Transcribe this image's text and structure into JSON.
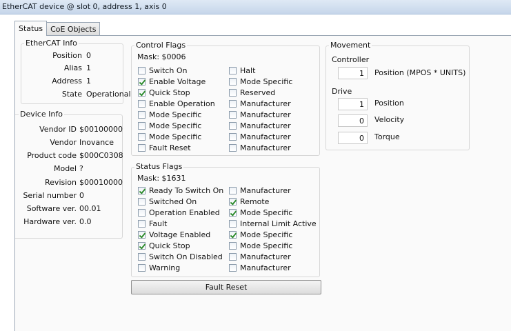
{
  "window": {
    "title": "EtherCAT device @ slot 0, address 1, axis 0"
  },
  "tabs": [
    {
      "label": "Status"
    },
    {
      "label": "CoE Objects"
    }
  ],
  "ethercat_info": {
    "title": "EtherCAT Info",
    "rows": [
      {
        "label": "Position",
        "value": "0"
      },
      {
        "label": "Alias",
        "value": "1"
      },
      {
        "label": "Address",
        "value": "1"
      },
      {
        "label": "State",
        "value": "Operational"
      }
    ]
  },
  "device_info": {
    "title": "Device Info",
    "rows": [
      {
        "label": "Vendor ID",
        "value": "$00100000"
      },
      {
        "label": "Vendor",
        "value": "Inovance"
      },
      {
        "label": "Product code",
        "value": "$000C0308"
      },
      {
        "label": "Model",
        "value": "?"
      },
      {
        "label": "Revision",
        "value": "$00010000"
      },
      {
        "label": "Serial number",
        "value": "0"
      },
      {
        "label": "Software ver.",
        "value": "00.01"
      },
      {
        "label": "Hardware ver.",
        "value": "0.0"
      }
    ]
  },
  "control_flags": {
    "title": "Control Flags",
    "mask": "Mask: $0006",
    "left": [
      {
        "label": "Switch On",
        "checked": false
      },
      {
        "label": "Enable Voltage",
        "checked": true
      },
      {
        "label": "Quick Stop",
        "checked": true
      },
      {
        "label": "Enable Operation",
        "checked": false
      },
      {
        "label": "Mode Specific",
        "checked": false
      },
      {
        "label": "Mode Specific",
        "checked": false
      },
      {
        "label": "Mode Specific",
        "checked": false
      },
      {
        "label": "Fault Reset",
        "checked": false
      }
    ],
    "right": [
      {
        "label": "Halt",
        "checked": false
      },
      {
        "label": "Mode Specific",
        "checked": false
      },
      {
        "label": "Reserved",
        "checked": false
      },
      {
        "label": "Manufacturer",
        "checked": false
      },
      {
        "label": "Manufacturer",
        "checked": false
      },
      {
        "label": "Manufacturer",
        "checked": false
      },
      {
        "label": "Manufacturer",
        "checked": false
      },
      {
        "label": "Manufacturer",
        "checked": false
      }
    ]
  },
  "status_flags": {
    "title": "Status Flags",
    "mask": "Mask: $1631",
    "left": [
      {
        "label": "Ready To Switch On",
        "checked": true
      },
      {
        "label": "Switched On",
        "checked": false
      },
      {
        "label": "Operation Enabled",
        "checked": false
      },
      {
        "label": "Fault",
        "checked": false
      },
      {
        "label": "Voltage Enabled",
        "checked": true
      },
      {
        "label": "Quick Stop",
        "checked": true
      },
      {
        "label": "Switch On Disabled",
        "checked": false
      },
      {
        "label": "Warning",
        "checked": false
      }
    ],
    "right": [
      {
        "label": "Manufacturer",
        "checked": false
      },
      {
        "label": "Remote",
        "checked": true
      },
      {
        "label": "Mode Specific",
        "checked": true
      },
      {
        "label": "Internal Limit Active",
        "checked": false
      },
      {
        "label": "Mode Specific",
        "checked": true
      },
      {
        "label": "Mode Specific",
        "checked": false
      },
      {
        "label": "Manufacturer",
        "checked": false
      },
      {
        "label": "Manufacturer",
        "checked": false
      }
    ]
  },
  "fault_reset_button": {
    "label": "Fault Reset"
  },
  "movement": {
    "title": "Movement",
    "controller_label": "Controller",
    "controller_position": {
      "value": "1",
      "label": "Position (MPOS * UNITS)"
    },
    "drive_label": "Drive",
    "drive": [
      {
        "value": "1",
        "label": "Position"
      },
      {
        "value": "0",
        "label": "Velocity"
      },
      {
        "value": "0",
        "label": "Torque"
      }
    ]
  }
}
